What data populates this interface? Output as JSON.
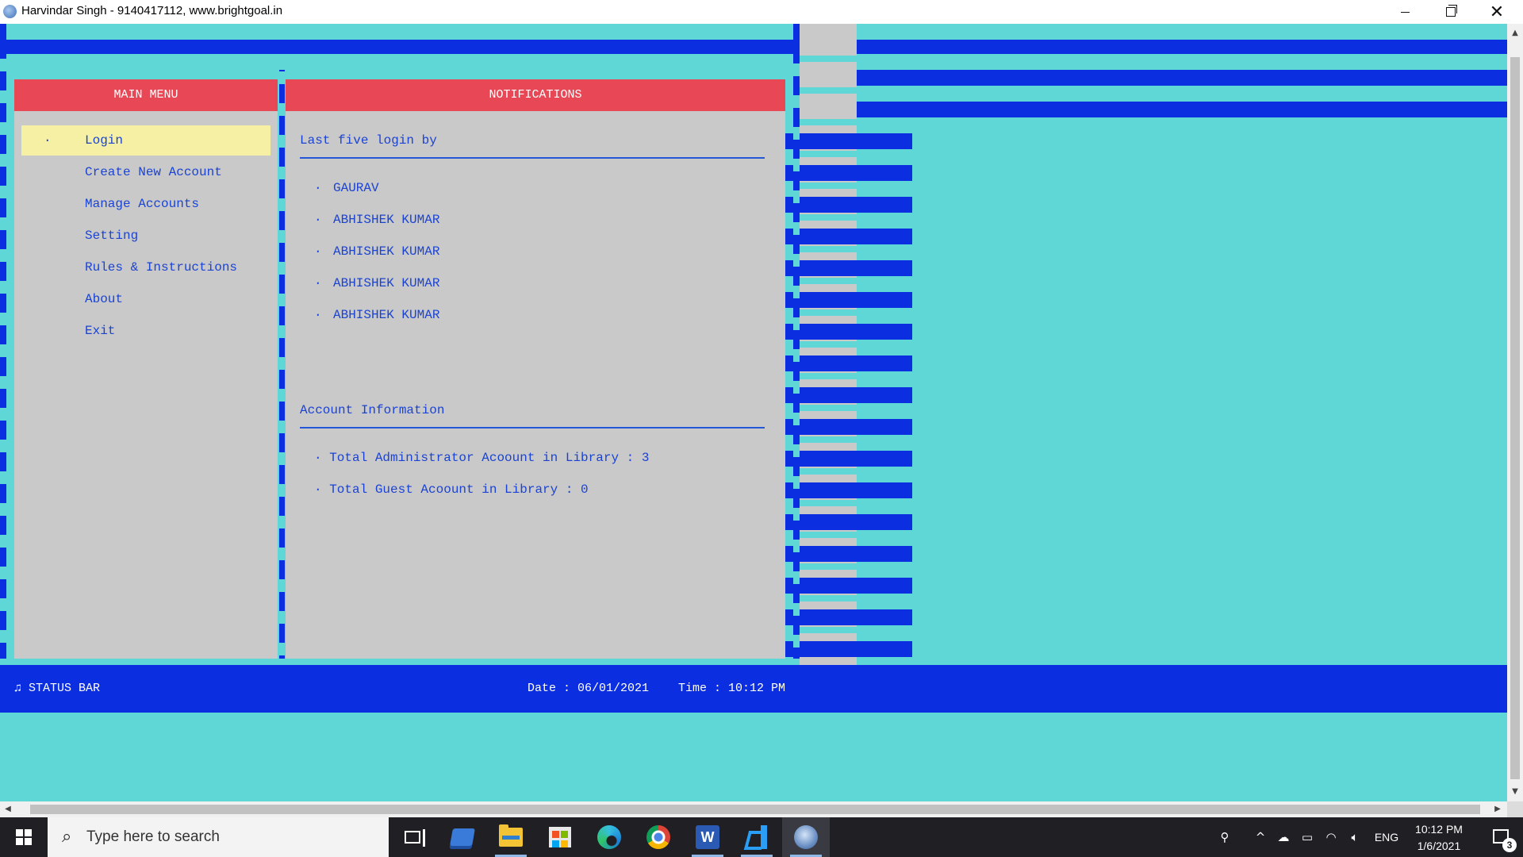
{
  "window": {
    "title": "Harvindar Singh - 9140417112, www.brightgoal.in",
    "controls": {
      "minimize": "minimize-icon",
      "restore": "restore-icon",
      "close": "✕"
    }
  },
  "main_menu": {
    "header": "MAIN MENU",
    "selected_marker": "·",
    "items": [
      {
        "label": "Login"
      },
      {
        "label": "Create New Account"
      },
      {
        "label": "Manage Accounts"
      },
      {
        "label": "Setting"
      },
      {
        "label": "Rules & Instructions"
      },
      {
        "label": "About"
      },
      {
        "label": "Exit"
      }
    ]
  },
  "notifications": {
    "header": "NOTIFICATIONS",
    "last_login_title": "Last five login by",
    "bullet": "·",
    "last_logins": [
      "GAURAV",
      "ABHISHEK KUMAR",
      "ABHISHEK KUMAR",
      "ABHISHEK KUMAR",
      "ABHISHEK KUMAR"
    ],
    "account_info_title": "Account Information",
    "account_info": [
      "· Total Administrator Acoount in Library : 3",
      "· Total Guest Acoount in Library : 0"
    ]
  },
  "status_bar": {
    "label": "♫ STATUS BAR",
    "date": "Date : 06/01/2021",
    "time": "Time : 10:12 PM"
  },
  "colors": {
    "console_bg": "#5fd7d7",
    "bar_blue": "#0b2ee0",
    "panel_grey": "#c9c9c9",
    "header_red": "#e84855",
    "highlight_yellow": "#f5f0a4",
    "text_blue": "#1b43d3"
  },
  "taskbar": {
    "search_placeholder": "Type here to search",
    "apps": [
      "task-view-icon",
      "file-manager-icon",
      "file-explorer-icon",
      "microsoft-store-icon",
      "edge-icon",
      "chrome-icon",
      "word-icon",
      "vscode-icon",
      "console-app-icon"
    ],
    "tray": {
      "language": "ENG",
      "clock_time": "10:12 PM",
      "clock_date": "1/6/2021",
      "notification_count": "3"
    }
  }
}
